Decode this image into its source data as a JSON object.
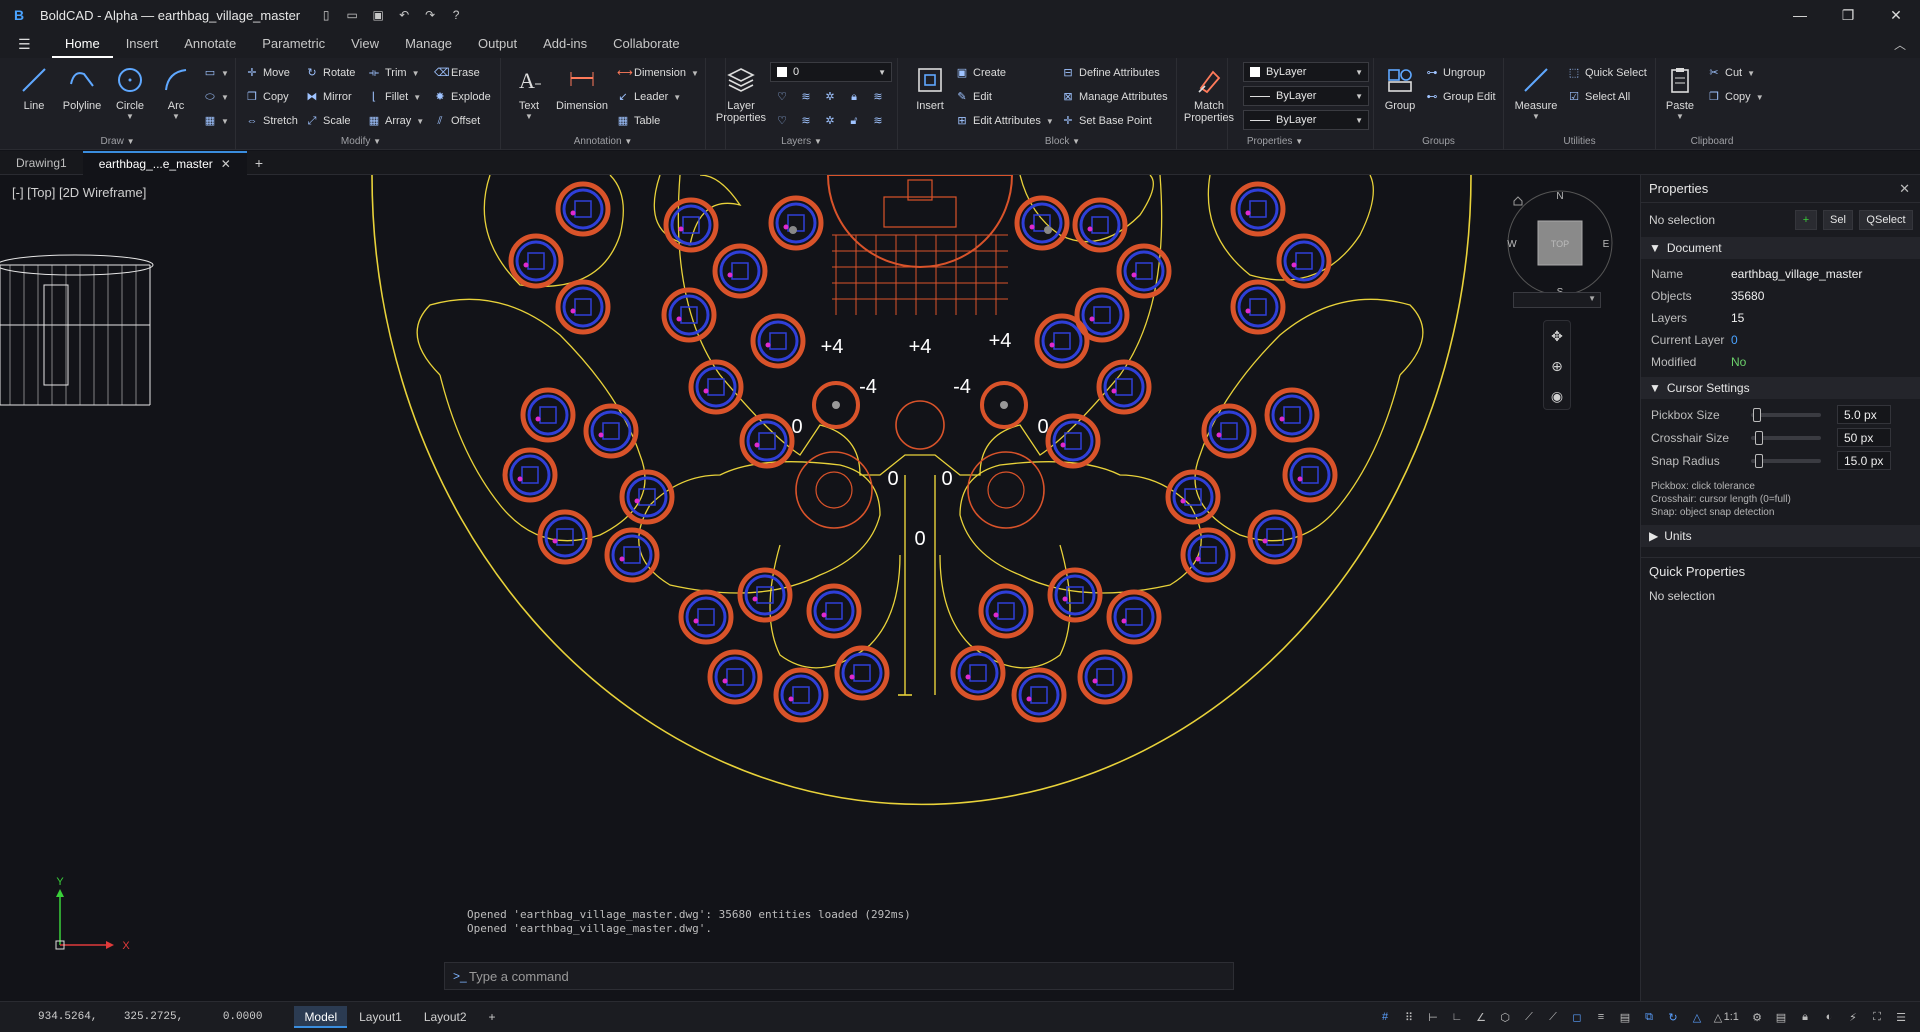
{
  "app": {
    "title": "BoldCAD - Alpha — earthbag_village_master",
    "logo": "B"
  },
  "ribbon_tabs": [
    "Home",
    "Insert",
    "Annotate",
    "Parametric",
    "View",
    "Manage",
    "Output",
    "Add-ins",
    "Collaborate"
  ],
  "ribbon": {
    "draw": {
      "title": "Draw",
      "line": "Line",
      "polyline": "Polyline",
      "circle": "Circle",
      "arc": "Arc"
    },
    "modify": {
      "title": "Modify",
      "move": "Move",
      "rotate": "Rotate",
      "trim": "Trim",
      "erase": "Erase",
      "copy": "Copy",
      "mirror": "Mirror",
      "fillet": "Fillet",
      "explode": "Explode",
      "stretch": "Stretch",
      "scale": "Scale",
      "array": "Array",
      "offset": "Offset"
    },
    "annotation": {
      "title": "Annotation",
      "text": "Text",
      "dimension_big": "Dimension",
      "dimension": "Dimension",
      "leader": "Leader",
      "table": "Table"
    },
    "layers": {
      "title": "Layers",
      "layer_properties_1": "Layer",
      "layer_properties_2": "Properties",
      "current_layer": "0"
    },
    "block": {
      "title": "Block",
      "insert": "Insert",
      "create": "Create",
      "edit": "Edit",
      "edit_attributes": "Edit Attributes",
      "define_attributes": "Define Attributes",
      "manage_attributes": "Manage Attributes",
      "set_base_point": "Set Base Point"
    },
    "properties": {
      "title": "Properties",
      "match_1": "Match",
      "match_2": "Properties",
      "color": "ByLayer",
      "linetype": "ByLayer",
      "lineweight": "ByLayer"
    },
    "groups": {
      "title": "Groups",
      "group": "Group",
      "ungroup": "Ungroup",
      "group_edit": "Group Edit"
    },
    "utilities": {
      "title": "Utilities",
      "measure": "Measure",
      "quick_select": "Quick Select",
      "select_all": "Select All"
    },
    "clipboard": {
      "title": "Clipboard",
      "paste": "Paste",
      "cut": "Cut",
      "copy": "Copy"
    }
  },
  "doc_tabs": [
    "Drawing1",
    "earthbag_...e_master"
  ],
  "viewport": {
    "label": "[-]  [Top]  [2D Wireframe]",
    "elevations": [
      "+4",
      "+4",
      "+4",
      "-4",
      "-4",
      "0",
      "0",
      "0",
      "0",
      "0"
    ],
    "compass": {
      "n": "N",
      "s": "S",
      "e": "E",
      "w": "W",
      "top": "TOP"
    },
    "ucs": {
      "x": "X",
      "y": "Y"
    }
  },
  "command": {
    "history": [
      "Opened 'earthbag_village_master.dwg': 35680 entities loaded (292ms)",
      "Opened 'earthbag_village_master.dwg'."
    ],
    "placeholder": "Type a command",
    "prompt": ">_"
  },
  "properties": {
    "title": "Properties",
    "selection": "No selection",
    "btn_add": "+",
    "btn_sel": "Sel",
    "btn_qselect": "QSelect",
    "document": {
      "title": "Document",
      "rows": [
        {
          "k": "Name",
          "v": "earthbag_village_master"
        },
        {
          "k": "Objects",
          "v": "35680"
        },
        {
          "k": "Layers",
          "v": "15"
        },
        {
          "k": "Current Layer",
          "v": "0"
        },
        {
          "k": "Modified",
          "v": "No"
        }
      ]
    },
    "cursor": {
      "title": "Cursor Settings",
      "rows": [
        {
          "k": "Pickbox Size",
          "v": "5.0 px",
          "level": 0.05
        },
        {
          "k": "Crosshair Size",
          "v": "50 px",
          "level": 0.08
        },
        {
          "k": "Snap Radius",
          "v": "15.0 px",
          "level": 0.08
        }
      ],
      "help": [
        "Pickbox: click tolerance",
        "Crosshair: cursor length (0=full)",
        "Snap: object snap detection"
      ]
    },
    "units": {
      "title": "Units"
    },
    "quick": {
      "title": "Quick Properties",
      "selection": "No selection"
    }
  },
  "status": {
    "coords": "934.5264,    325.2725,      0.0000",
    "tabs": [
      "Model",
      "Layout1",
      "Layout2"
    ],
    "add": "+",
    "scale": "1:1"
  },
  "colors": {
    "accent": "#3a8dde",
    "drawing_yellow": "#e8d23a",
    "pod_orange": "#d9532a",
    "pod_blue": "#2f3fd8",
    "pod_magenta": "#e02ad0"
  }
}
